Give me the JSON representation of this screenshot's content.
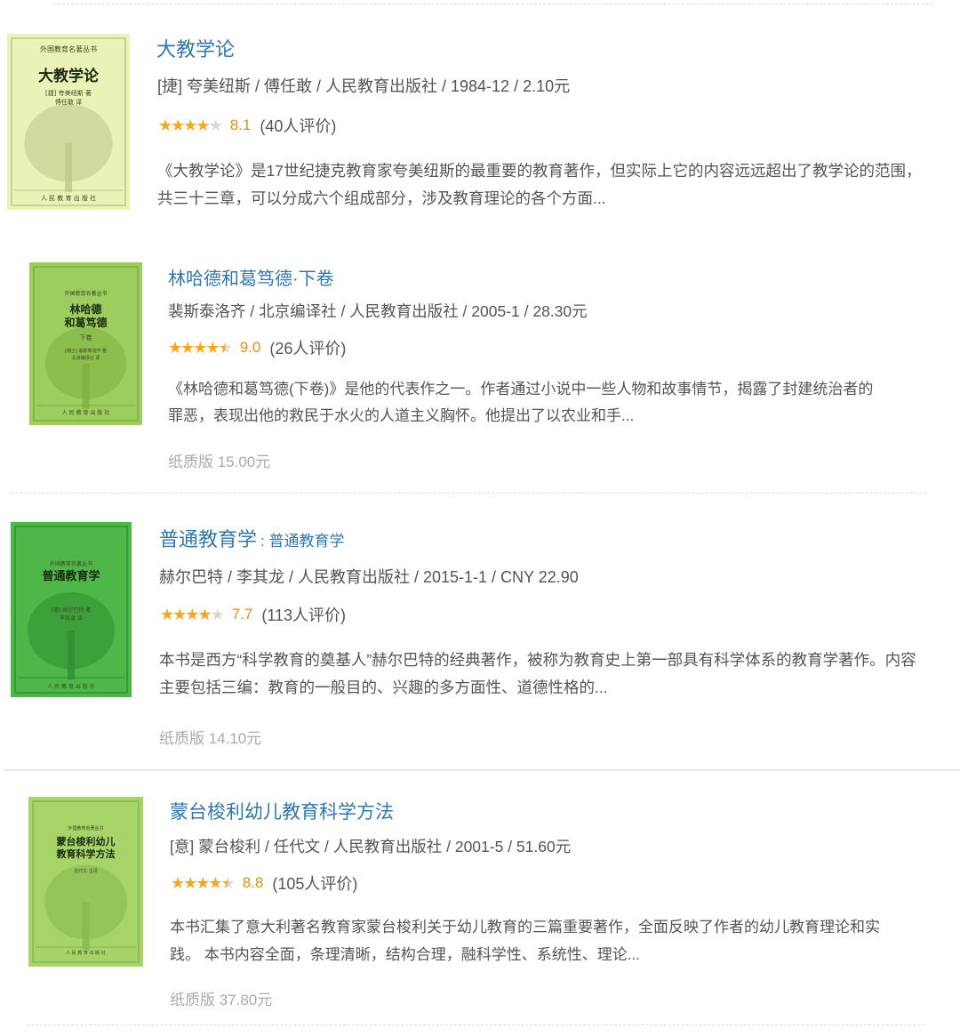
{
  "books": [
    {
      "cover": {
        "title": "大教学论",
        "series": "外国教育名著丛书",
        "author": "[捷] 夸美纽斯 著",
        "translator": "傅任敢 译",
        "publisher": "人 民 教 育 出 版 社",
        "color": "#eaf2b8",
        "tree_color": "#b9c88a"
      },
      "title": "大教学论",
      "subtitle": "",
      "pub_info": "[捷] 夸美纽斯 / 傅任敢 / 人民教育出版社 / 1984-12 / 2.10元",
      "rating": 8.1,
      "stars": "4",
      "score_label": "8.1",
      "ratings_count": "(40人评价)",
      "description": "《大教学论》是17世纪捷克教育家夸美纽斯的最重要的教育著作，但实际上它的内容远远超出了教学论的范围，共三十三章，可以分成六个组成部分，涉及教育理论的各个方面...",
      "price": ""
    },
    {
      "cover": {
        "title": "林哈德\n和葛笃德",
        "series": "外国教育名著丛书",
        "volume": "下卷",
        "author": "[瑞士] 裴斯泰洛齐 著",
        "translator": "北京编译社 译",
        "publisher": "人 民 教 育 出 版 社",
        "color": "#9dcd5e",
        "tree_color": "#7db040"
      },
      "title": "林哈德和葛笃德·下卷",
      "subtitle": "",
      "pub_info": "裴斯泰洛齐 / 北京编译社 / 人民教育出版社 / 2005-1 / 28.30元",
      "rating": 9.0,
      "stars": "4.5",
      "score_label": "9.0",
      "ratings_count": "(26人评价)",
      "description": "《林哈德和葛笃德(下卷)》是他的代表作之一。作者通过小说中一些人物和故事情节，揭露了封建统治者的罪恶，表现出他的救民于水火的人道主义胸怀。他提出了以农业和手...",
      "price": "纸质版 15.00元"
    },
    {
      "cover": {
        "title": "普通教育学",
        "series": "外国教育名著丛书",
        "author": "[德] 赫尔巴特 著",
        "translator": "李其龙 译",
        "publisher": "人 民 教 育 出 版 社",
        "color": "#4fb64a",
        "tree_color": "#2f8f30"
      },
      "title": "普通教育学",
      "subtitle": ": 普通教育学",
      "pub_info": "赫尔巴特 / 李其龙 / 人民教育出版社 / 2015-1-1 / CNY 22.90",
      "rating": 7.7,
      "stars": "4",
      "score_label": "7.7",
      "ratings_count": "(113人评价)",
      "description": "本书是西方“科学教育的奠基人”赫尔巴特的经典著作，被称为教育史上第一部具有科学体系的教育学著作。内容主要包括三编：教育的一般目的、兴趣的多方面性、道德性格的...",
      "price": "纸质版 14.10元"
    },
    {
      "cover": {
        "title": "蒙台梭利幼儿\n教育科学方法",
        "series": "外国教育名著丛书",
        "author": "任代文 主译",
        "translator": "",
        "publisher": "人 民 教 育 出 版 社",
        "color": "#a7d468",
        "tree_color": "#86b84c"
      },
      "title": "蒙台梭利幼儿教育科学方法",
      "subtitle": "",
      "pub_info": "[意] 蒙台梭利 / 任代文 / 人民教育出版社 / 2001-5 / 51.60元",
      "rating": 8.8,
      "stars": "4.5",
      "score_label": "8.8",
      "ratings_count": "(105人评价)",
      "description": "本书汇集了意大利著名教育家蒙台梭利关于幼儿教育的三篇重要著作，全面反映了作者的幼儿教育理论和实践。 本书内容全面，条理清晰，结构合理，融科学性、系统性、理论...",
      "price": "纸质版 37.80元"
    }
  ]
}
